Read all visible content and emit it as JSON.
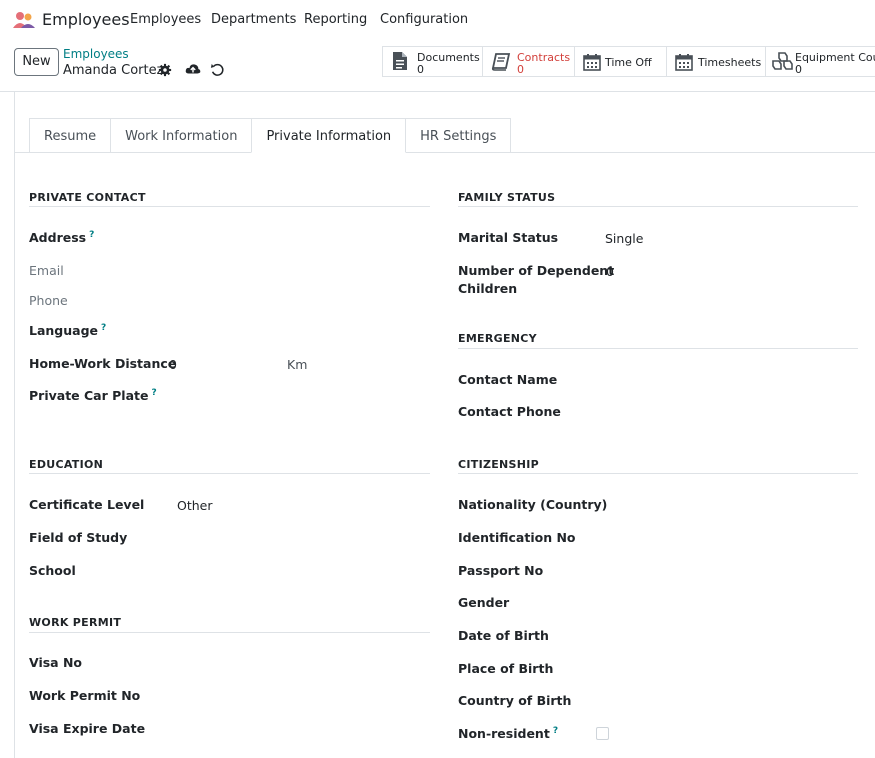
{
  "navbar": {
    "app_name": "Employees",
    "menu": [
      "Employees",
      "Departments",
      "Reporting",
      "Configuration"
    ]
  },
  "control": {
    "new_label": "New",
    "breadcrumb_parent": "Employees",
    "breadcrumb_current": "Amanda Cortez"
  },
  "smart_buttons": [
    {
      "label": "Documents",
      "count": "0",
      "icon": "document-icon"
    },
    {
      "label": "Contracts",
      "count": "0",
      "icon": "contract-book-icon",
      "color": "#d23f3a"
    },
    {
      "label": "Time Off",
      "count": "",
      "icon": "calendar-icon"
    },
    {
      "label": "Timesheets",
      "count": "",
      "icon": "calendar-icon"
    },
    {
      "label": "Equipment Cour",
      "count": "0",
      "icon": "cubes-icon"
    }
  ],
  "tabs": [
    "Resume",
    "Work Information",
    "Private Information",
    "HR Settings"
  ],
  "active_tab": "Private Information",
  "private_contact": {
    "title": "PRIVATE CONTACT",
    "address": "Address",
    "email": "Email",
    "phone": "Phone",
    "language": "Language",
    "distance_label": "Home-Work Distance",
    "distance_value": "0",
    "distance_unit": "Km",
    "car_plate": "Private Car Plate"
  },
  "family_status": {
    "title": "FAMILY STATUS",
    "marital_label": "Marital Status",
    "marital_value": "Single",
    "children_label_1": "Number of Dependent",
    "children_label_2": "Children",
    "children_value": "0"
  },
  "emergency": {
    "title": "EMERGENCY",
    "contact_name": "Contact Name",
    "contact_phone": "Contact Phone"
  },
  "education": {
    "title": "EDUCATION",
    "certificate_label": "Certificate Level",
    "certificate_value": "Other",
    "field_of_study": "Field of Study",
    "school": "School"
  },
  "citizenship": {
    "title": "CITIZENSHIP",
    "nationality": "Nationality (Country)",
    "identification": "Identification No",
    "passport": "Passport No",
    "gender": "Gender",
    "dob": "Date of Birth",
    "pob": "Place of Birth",
    "cob": "Country of Birth",
    "non_resident": "Non-resident"
  },
  "work_permit": {
    "title": "WORK PERMIT",
    "visa_no": "Visa No",
    "permit_no": "Work Permit No",
    "visa_expire": "Visa Expire Date"
  },
  "help_marker": "?",
  "colors": {
    "accent": "#017e84",
    "brand": "#714b67",
    "danger": "#d23f3a"
  }
}
